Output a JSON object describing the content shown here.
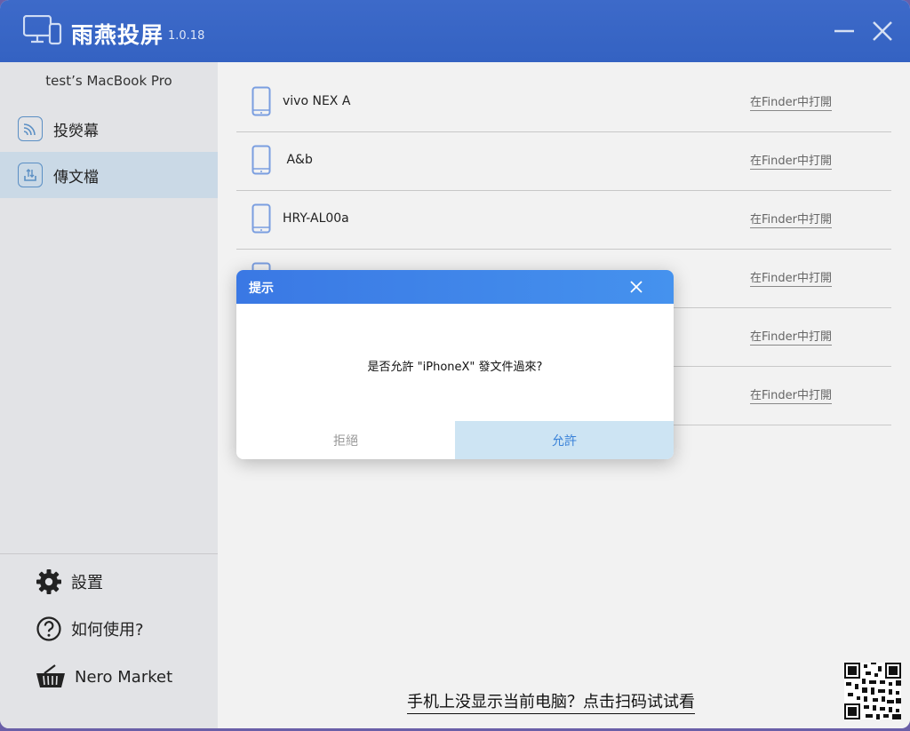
{
  "app": {
    "title": "雨燕投屏",
    "version": "1.0.18",
    "logo_icon": "screen-mirror-icon",
    "accent": "#3462c2"
  },
  "sidebar": {
    "device_name": "test’s MacBook Pro",
    "items": [
      {
        "label": "投熒幕",
        "icon": "cast-icon",
        "active": false
      },
      {
        "label": "傳文檔",
        "icon": "file-transfer-icon",
        "active": true
      }
    ],
    "bottom": [
      {
        "label": "設置",
        "icon": "gear-icon"
      },
      {
        "label": "如何使用?",
        "icon": "help-icon"
      },
      {
        "label": "Nero Market",
        "icon": "basket-icon"
      }
    ]
  },
  "devices": [
    {
      "name": "vivo NEX A",
      "link": "在Finder中打開"
    },
    {
      "name": " A&b",
      "link": "在Finder中打開"
    },
    {
      "name": "HRY-AL00a",
      "link": "在Finder中打開"
    },
    {
      "name": "",
      "link": "在Finder中打開"
    },
    {
      "name": "",
      "link": "在Finder中打開"
    },
    {
      "name": "",
      "link": "在Finder中打開"
    }
  ],
  "footer": {
    "scan_hint": "手机上没显示当前电脑？点击扫码试试看"
  },
  "dialog": {
    "title": "提示",
    "message": "是否允許 \"iPhoneX\" 發文件過來?",
    "reject_label": "拒絕",
    "allow_label": "允許"
  }
}
